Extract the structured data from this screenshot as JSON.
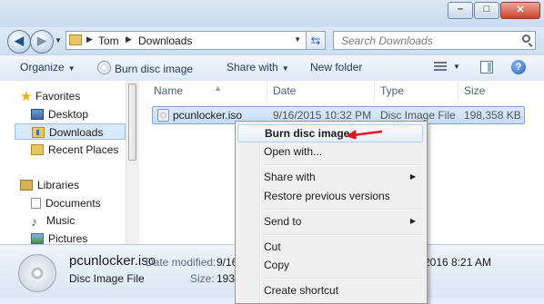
{
  "window": {
    "controls": [
      {
        "name": "minimize",
        "glyph": "–"
      },
      {
        "name": "maximize",
        "glyph": "□"
      },
      {
        "name": "close",
        "glyph": "✕"
      }
    ]
  },
  "address_bar": {
    "crumbs": [
      "Tom",
      "Downloads"
    ],
    "back_glyph": "◀",
    "forward_glyph": "▶",
    "refresh_glyph": "⇆"
  },
  "search": {
    "placeholder": "Search Downloads"
  },
  "toolbar": {
    "organize": "Organize",
    "burn": "Burn disc image",
    "share_with": "Share with",
    "new_folder": "New folder",
    "help": "?"
  },
  "nav": {
    "favorites": "Favorites",
    "desktop": "Desktop",
    "downloads": "Downloads",
    "recent_places": "Recent Places",
    "libraries": "Libraries",
    "documents": "Documents",
    "music": "Music",
    "pictures": "Pictures"
  },
  "columns": {
    "name": "Name",
    "date": "Date",
    "type": "Type",
    "size": "Size"
  },
  "files": [
    {
      "name": "pcunlocker.iso",
      "date": "9/16/2015 10:32 PM",
      "type": "Disc Image File",
      "size": "198,358 KB"
    }
  ],
  "details": {
    "name": "pcunlocker.iso",
    "type": "Disc Image File",
    "date_label": "Date modified:",
    "date_value_left": "9/16",
    "date_value_right": "2016 8:21 AM",
    "size_label": "Size:",
    "size_value": "193"
  },
  "context_menu": {
    "burn": "Burn disc image",
    "open_with": "Open with...",
    "share_with": "Share with",
    "restore": "Restore previous versions",
    "send_to": "Send to",
    "cut": "Cut",
    "copy": "Copy",
    "create_shortcut": "Create shortcut",
    "submenu_arrow": "▶"
  },
  "colors": {
    "annotation_arrow": "#e0141e",
    "selection": "#cfe3fa"
  }
}
